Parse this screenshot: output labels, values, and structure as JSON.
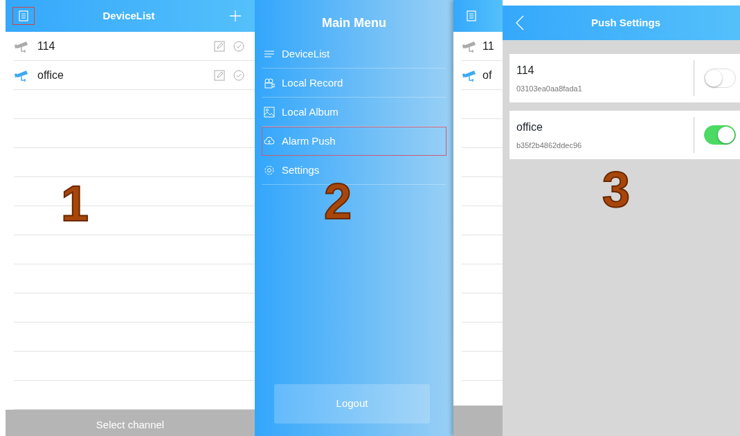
{
  "device_list": {
    "title": "DeviceList",
    "menu_button": {
      "highlighted": true
    },
    "rows": [
      {
        "name": "114",
        "online": false
      },
      {
        "name": "office",
        "online": true
      }
    ],
    "bottom_button": "Select channel",
    "step": "1"
  },
  "main_menu": {
    "title": "Main Menu",
    "items": [
      {
        "label": "DeviceList",
        "kind": "list",
        "highlighted": false
      },
      {
        "label": "Local Record",
        "kind": "record",
        "highlighted": false
      },
      {
        "label": "Local Album",
        "kind": "album",
        "highlighted": false
      },
      {
        "label": "Alarm Push",
        "kind": "cloud",
        "highlighted": true
      },
      {
        "label": "Settings",
        "kind": "gear",
        "highlighted": false
      }
    ],
    "logout": "Logout",
    "step": "2",
    "peek_rows": [
      {
        "name": "11",
        "online": false
      },
      {
        "name": "of",
        "online": true
      }
    ]
  },
  "push_settings": {
    "title": "Push Settings",
    "devices": [
      {
        "name": "114",
        "id": "03103ea0aa8fada1",
        "on": false
      },
      {
        "name": "office",
        "id": "b35f2b4862ddec96",
        "on": true
      }
    ],
    "step": "3"
  }
}
